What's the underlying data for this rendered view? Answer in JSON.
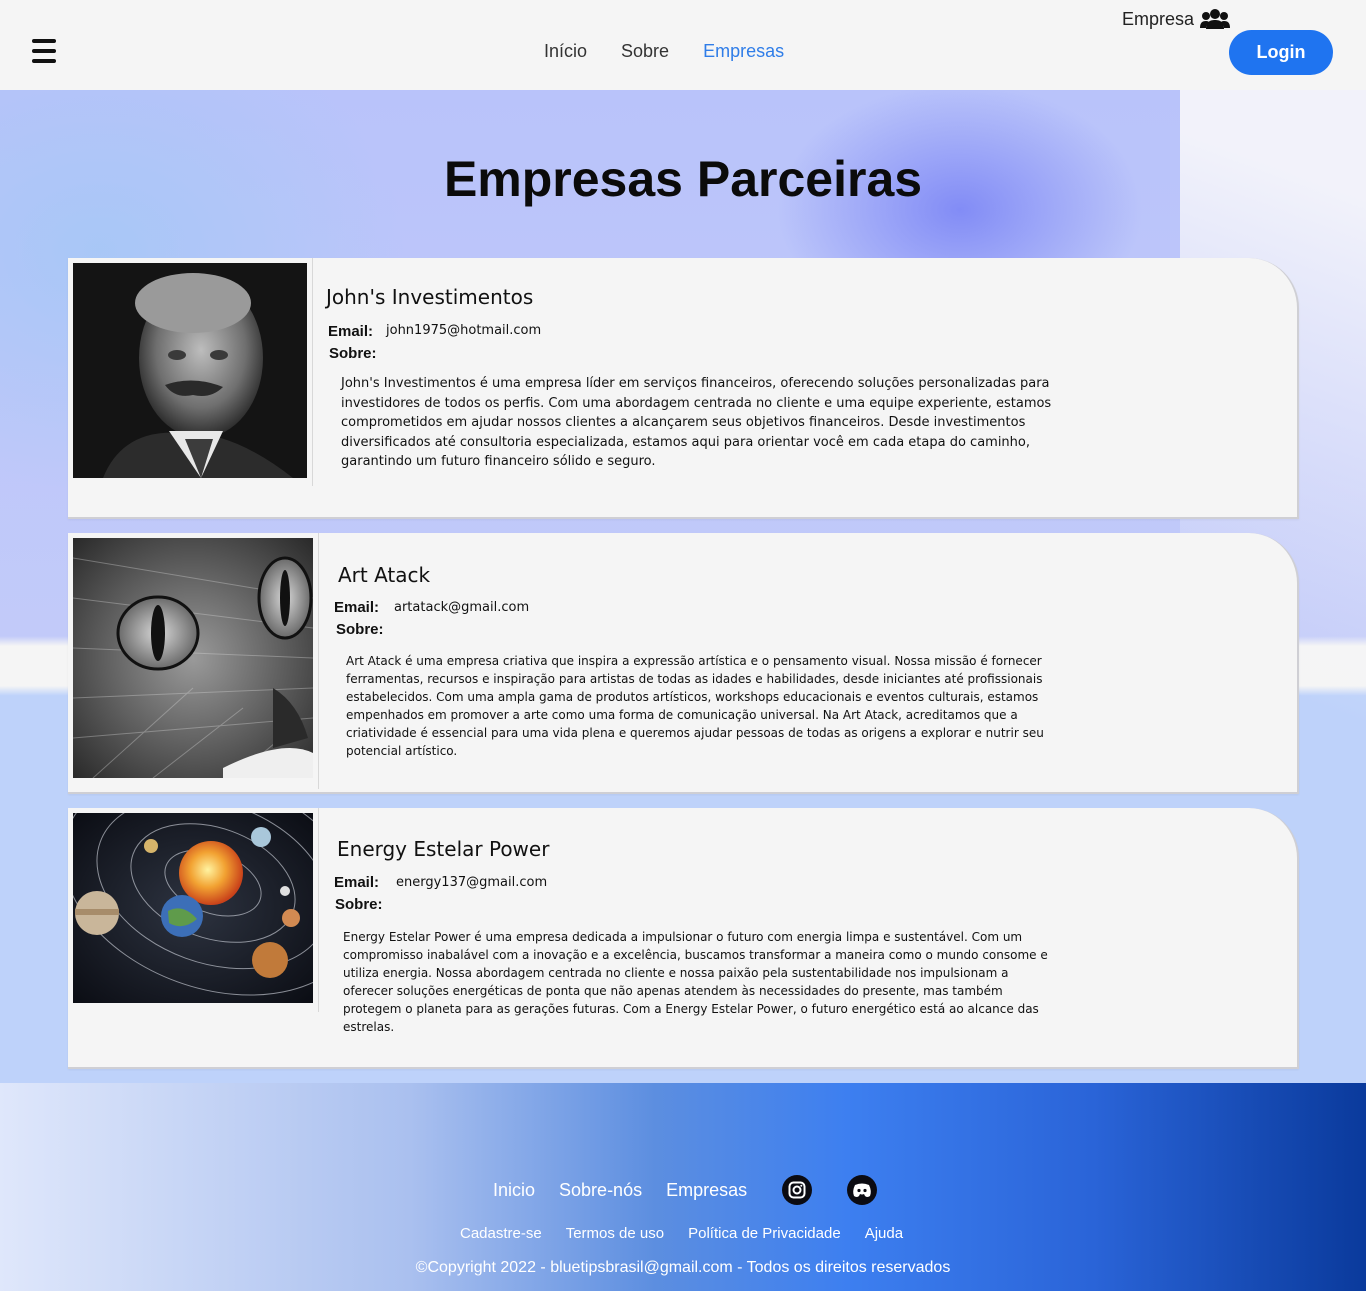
{
  "header": {
    "nav": [
      "Início",
      "Sobre",
      "Empresas"
    ],
    "active_nav": "Empresas",
    "empresa_label": "Empresa",
    "login_label": "Login"
  },
  "page": {
    "title": "Empresas Parceiras"
  },
  "companies": [
    {
      "name": "John's Investimentos",
      "email_label": "Email:",
      "email": "john1975@hotmail.com",
      "sobre_label": "Sobre:",
      "description": "John's Investimentos é uma empresa líder em serviços financeiros, oferecendo soluções personalizadas para investidores de todos os perfis. Com uma abordagem centrada no cliente e uma equipe experiente, estamos comprometidos em ajudar nossos clientes a alcançarem seus objetivos financeiros. Desde investimentos diversificados até consultoria especializada, estamos aqui para orientar você em cada etapa do caminho, garantindo um futuro financeiro sólido e seguro.",
      "image": "portrait-photo"
    },
    {
      "name": "Art Atack",
      "email_label": "Email:",
      "email": "artatack@gmail.com",
      "sobre_label": "Sobre:",
      "description": "Art Atack é uma empresa criativa que inspira a expressão artística e o pensamento visual. Nossa missão é fornecer ferramentas, recursos e inspiração para artistas de todas as idades e habilidades, desde iniciantes até profissionais estabelecidos. Com uma ampla gama de produtos artísticos, workshops educacionais e eventos culturais, estamos empenhados em promover a arte como uma forma de comunicação universal. Na Art Atack, acreditamos que a criatividade é essencial para uma vida plena e queremos ajudar pessoas de todas as origens a explorar e nutrir seu potencial artístico.",
      "image": "cat-drawing"
    },
    {
      "name": "Energy Estelar Power",
      "email_label": "Email:",
      "email": "energy137@gmail.com",
      "sobre_label": "Sobre:",
      "description": "Energy Estelar Power é uma empresa dedicada a impulsionar o futuro com energia limpa e sustentável. Com um compromisso inabalável com a inovação e a excelência, buscamos transformar a maneira como o mundo consome e utiliza energia. Nossa abordagem centrada no cliente e nossa paixão pela sustentabilidade nos impulsionam a oferecer soluções energéticas de ponta que não apenas atendem às necessidades do presente, mas também protegem o planeta para as gerações futuras. Com a Energy Estelar Power, o futuro energético está ao alcance das estrelas.",
      "image": "solar-system"
    }
  ],
  "footer": {
    "nav": [
      "Inicio",
      "Sobre-nós",
      "Empresas"
    ],
    "social": [
      "instagram-icon",
      "discord-icon"
    ],
    "links": [
      "Cadastre-se",
      "Termos de uso",
      "Política de Privacidade",
      "Ajuda"
    ],
    "copyright": "©Copyright 2022 - bluetipsbrasil@gmail.com - Todos os direitos reservados"
  },
  "colors": {
    "accent": "#1f74f0",
    "active_nav": "#2f7de8"
  }
}
